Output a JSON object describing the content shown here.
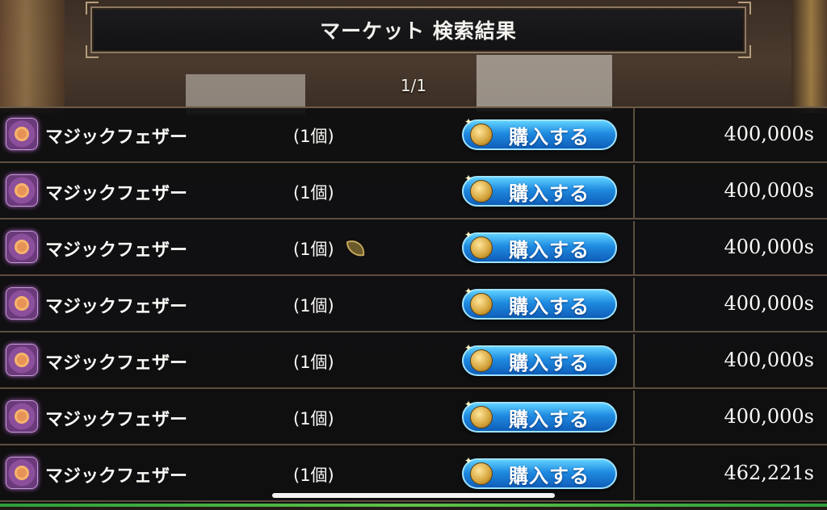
{
  "header": {
    "title": "マーケット 検索結果"
  },
  "pager": {
    "text": "1/1"
  },
  "rows": [
    {
      "name": "マジックフェザー",
      "qty": "(1個)",
      "buy_label": "購入する",
      "price": "400,000s",
      "has_seed_icon": false
    },
    {
      "name": "マジックフェザー",
      "qty": "(1個)",
      "buy_label": "購入する",
      "price": "400,000s",
      "has_seed_icon": false
    },
    {
      "name": "マジックフェザー",
      "qty": "(1個)",
      "buy_label": "購入する",
      "price": "400,000s",
      "has_seed_icon": true
    },
    {
      "name": "マジックフェザー",
      "qty": "(1個)",
      "buy_label": "購入する",
      "price": "400,000s",
      "has_seed_icon": false
    },
    {
      "name": "マジックフェザー",
      "qty": "(1個)",
      "buy_label": "購入する",
      "price": "400,000s",
      "has_seed_icon": false
    },
    {
      "name": "マジックフェザー",
      "qty": "(1個)",
      "buy_label": "購入する",
      "price": "400,000s",
      "has_seed_icon": false
    },
    {
      "name": "マジックフェザー",
      "qty": "(1個)",
      "buy_label": "購入する",
      "price": "462,221s",
      "has_seed_icon": false
    }
  ],
  "icons": {
    "item": "magic-feather-icon",
    "buy": "coin-icon",
    "extra": "seed-icon"
  },
  "colors": {
    "button_top": "#5fd1ff",
    "button_bottom": "#0f5db8",
    "frame": "#8d7a63"
  }
}
